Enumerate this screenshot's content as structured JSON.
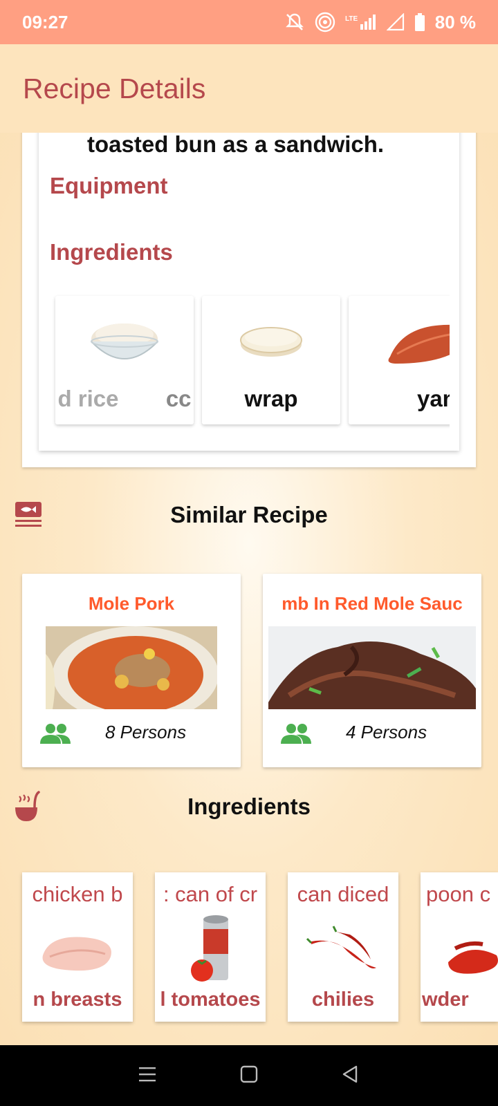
{
  "status_bar": {
    "time": "09:27",
    "battery": "80 %"
  },
  "app_bar": {
    "title": "Recipe Details"
  },
  "detail": {
    "instruction_tail": "toasted bun as a sandwich.",
    "equipment_heading": "Equipment",
    "ingredients_heading": "Ingredients",
    "ingredients": [
      {
        "name": "d rice",
        "name_overflow": "cc",
        "icon": "rice-bowl-icon"
      },
      {
        "name": "wrap",
        "icon": "tortilla-icon"
      },
      {
        "name": "yam",
        "icon": "sweet-potato-icon"
      }
    ]
  },
  "similar": {
    "heading": "Similar Recipe",
    "recipes": [
      {
        "name": "Mole Pork",
        "persons": "8 Persons"
      },
      {
        "name": "mb In Red Mole Sauc",
        "persons": "4 Persons"
      }
    ]
  },
  "ingredients_section": {
    "heading": "Ingredients",
    "items": [
      {
        "qty": "chicken b",
        "name": "n breasts",
        "icon": "chicken-breast-icon"
      },
      {
        "qty": ": can of cr",
        "name": "l tomatoes",
        "icon": "tomato-can-icon"
      },
      {
        "qty": "can diced",
        "name": "chilies",
        "icon": "red-chili-icon"
      },
      {
        "qty": "poon c",
        "name": "wder",
        "icon": "chili-powder-icon"
      }
    ]
  },
  "colors": {
    "accent": "#b5484c",
    "orange": "#ff5a2c",
    "green": "#4caf50",
    "status": "#ff9f82",
    "background": "#fde4bd"
  }
}
